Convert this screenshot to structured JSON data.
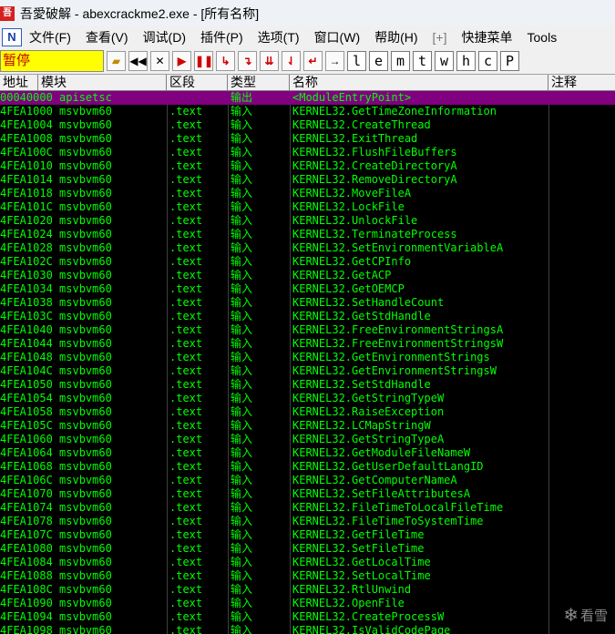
{
  "window": {
    "title": "吾愛破解 - abexcrackme2.exe - [所有名称]",
    "icon": "app-icon"
  },
  "menubar": {
    "logo": "N",
    "items": [
      "文件(F)",
      "查看(V)",
      "调试(D)",
      "插件(P)",
      "选项(T)",
      "窗口(W)",
      "帮助(H)",
      "[+]",
      "快捷菜单",
      "Tools"
    ]
  },
  "toolbar": {
    "status": "暂停",
    "letters": [
      "l",
      "e",
      "m",
      "t",
      "w",
      "h",
      "c",
      "P"
    ]
  },
  "table": {
    "headers": [
      "地址",
      "模块",
      "区段",
      "类型",
      "名称",
      "注释"
    ],
    "selected": {
      "addr": "00040000",
      "module": "apisetsc",
      "section": "",
      "type": "输出",
      "name": "<ModuleEntryPoint>"
    },
    "rows": [
      {
        "addr": "4FEA1000",
        "module": "msvbvm60",
        "section": ".text",
        "type": "输入",
        "name": "KERNEL32.GetTimeZoneInformation"
      },
      {
        "addr": "4FEA1004",
        "module": "msvbvm60",
        "section": ".text",
        "type": "输入",
        "name": "KERNEL32.CreateThread"
      },
      {
        "addr": "4FEA1008",
        "module": "msvbvm60",
        "section": ".text",
        "type": "输入",
        "name": "KERNEL32.ExitThread"
      },
      {
        "addr": "4FEA100C",
        "module": "msvbvm60",
        "section": ".text",
        "type": "输入",
        "name": "KERNEL32.FlushFileBuffers"
      },
      {
        "addr": "4FEA1010",
        "module": "msvbvm60",
        "section": ".text",
        "type": "输入",
        "name": "KERNEL32.CreateDirectoryA"
      },
      {
        "addr": "4FEA1014",
        "module": "msvbvm60",
        "section": ".text",
        "type": "输入",
        "name": "KERNEL32.RemoveDirectoryA"
      },
      {
        "addr": "4FEA1018",
        "module": "msvbvm60",
        "section": ".text",
        "type": "输入",
        "name": "KERNEL32.MoveFileA"
      },
      {
        "addr": "4FEA101C",
        "module": "msvbvm60",
        "section": ".text",
        "type": "输入",
        "name": "KERNEL32.LockFile"
      },
      {
        "addr": "4FEA1020",
        "module": "msvbvm60",
        "section": ".text",
        "type": "输入",
        "name": "KERNEL32.UnlockFile"
      },
      {
        "addr": "4FEA1024",
        "module": "msvbvm60",
        "section": ".text",
        "type": "输入",
        "name": "KERNEL32.TerminateProcess"
      },
      {
        "addr": "4FEA1028",
        "module": "msvbvm60",
        "section": ".text",
        "type": "输入",
        "name": "KERNEL32.SetEnvironmentVariableA"
      },
      {
        "addr": "4FEA102C",
        "module": "msvbvm60",
        "section": ".text",
        "type": "输入",
        "name": "KERNEL32.GetCPInfo"
      },
      {
        "addr": "4FEA1030",
        "module": "msvbvm60",
        "section": ".text",
        "type": "输入",
        "name": "KERNEL32.GetACP"
      },
      {
        "addr": "4FEA1034",
        "module": "msvbvm60",
        "section": ".text",
        "type": "输入",
        "name": "KERNEL32.GetOEMCP"
      },
      {
        "addr": "4FEA1038",
        "module": "msvbvm60",
        "section": ".text",
        "type": "输入",
        "name": "KERNEL32.SetHandleCount"
      },
      {
        "addr": "4FEA103C",
        "module": "msvbvm60",
        "section": ".text",
        "type": "输入",
        "name": "KERNEL32.GetStdHandle"
      },
      {
        "addr": "4FEA1040",
        "module": "msvbvm60",
        "section": ".text",
        "type": "输入",
        "name": "KERNEL32.FreeEnvironmentStringsA"
      },
      {
        "addr": "4FEA1044",
        "module": "msvbvm60",
        "section": ".text",
        "type": "输入",
        "name": "KERNEL32.FreeEnvironmentStringsW"
      },
      {
        "addr": "4FEA1048",
        "module": "msvbvm60",
        "section": ".text",
        "type": "输入",
        "name": "KERNEL32.GetEnvironmentStrings"
      },
      {
        "addr": "4FEA104C",
        "module": "msvbvm60",
        "section": ".text",
        "type": "输入",
        "name": "KERNEL32.GetEnvironmentStringsW"
      },
      {
        "addr": "4FEA1050",
        "module": "msvbvm60",
        "section": ".text",
        "type": "输入",
        "name": "KERNEL32.SetStdHandle"
      },
      {
        "addr": "4FEA1054",
        "module": "msvbvm60",
        "section": ".text",
        "type": "输入",
        "name": "KERNEL32.GetStringTypeW"
      },
      {
        "addr": "4FEA1058",
        "module": "msvbvm60",
        "section": ".text",
        "type": "输入",
        "name": "KERNEL32.RaiseException"
      },
      {
        "addr": "4FEA105C",
        "module": "msvbvm60",
        "section": ".text",
        "type": "输入",
        "name": "KERNEL32.LCMapStringW"
      },
      {
        "addr": "4FEA1060",
        "module": "msvbvm60",
        "section": ".text",
        "type": "输入",
        "name": "KERNEL32.GetStringTypeA"
      },
      {
        "addr": "4FEA1064",
        "module": "msvbvm60",
        "section": ".text",
        "type": "输入",
        "name": "KERNEL32.GetModuleFileNameW"
      },
      {
        "addr": "4FEA1068",
        "module": "msvbvm60",
        "section": ".text",
        "type": "输入",
        "name": "KERNEL32.GetUserDefaultLangID"
      },
      {
        "addr": "4FEA106C",
        "module": "msvbvm60",
        "section": ".text",
        "type": "输入",
        "name": "KERNEL32.GetComputerNameA"
      },
      {
        "addr": "4FEA1070",
        "module": "msvbvm60",
        "section": ".text",
        "type": "输入",
        "name": "KERNEL32.SetFileAttributesA"
      },
      {
        "addr": "4FEA1074",
        "module": "msvbvm60",
        "section": ".text",
        "type": "输入",
        "name": "KERNEL32.FileTimeToLocalFileTime"
      },
      {
        "addr": "4FEA1078",
        "module": "msvbvm60",
        "section": ".text",
        "type": "输入",
        "name": "KERNEL32.FileTimeToSystemTime"
      },
      {
        "addr": "4FEA107C",
        "module": "msvbvm60",
        "section": ".text",
        "type": "输入",
        "name": "KERNEL32.GetFileTime"
      },
      {
        "addr": "4FEA1080",
        "module": "msvbvm60",
        "section": ".text",
        "type": "输入",
        "name": "KERNEL32.SetFileTime"
      },
      {
        "addr": "4FEA1084",
        "module": "msvbvm60",
        "section": ".text",
        "type": "输入",
        "name": "KERNEL32.GetLocalTime"
      },
      {
        "addr": "4FEA1088",
        "module": "msvbvm60",
        "section": ".text",
        "type": "输入",
        "name": "KERNEL32.SetLocalTime"
      },
      {
        "addr": "4FEA108C",
        "module": "msvbvm60",
        "section": ".text",
        "type": "输入",
        "name": "KERNEL32.RtlUnwind"
      },
      {
        "addr": "4FEA1090",
        "module": "msvbvm60",
        "section": ".text",
        "type": "输入",
        "name": "KERNEL32.OpenFile"
      },
      {
        "addr": "4FEA1094",
        "module": "msvbvm60",
        "section": ".text",
        "type": "输入",
        "name": "KERNEL32.CreateProcessW"
      },
      {
        "addr": "4FEA1098",
        "module": "msvbvm60",
        "section": ".text",
        "type": "输入",
        "name": "KERNEL32.IsValidCodePage"
      }
    ]
  },
  "watermark": {
    "text": "看雪"
  },
  "colors": {
    "text_green": "#00ff00",
    "selected_bg": "#800080",
    "status_bg": "#ffff00",
    "status_text": "#c00000"
  }
}
